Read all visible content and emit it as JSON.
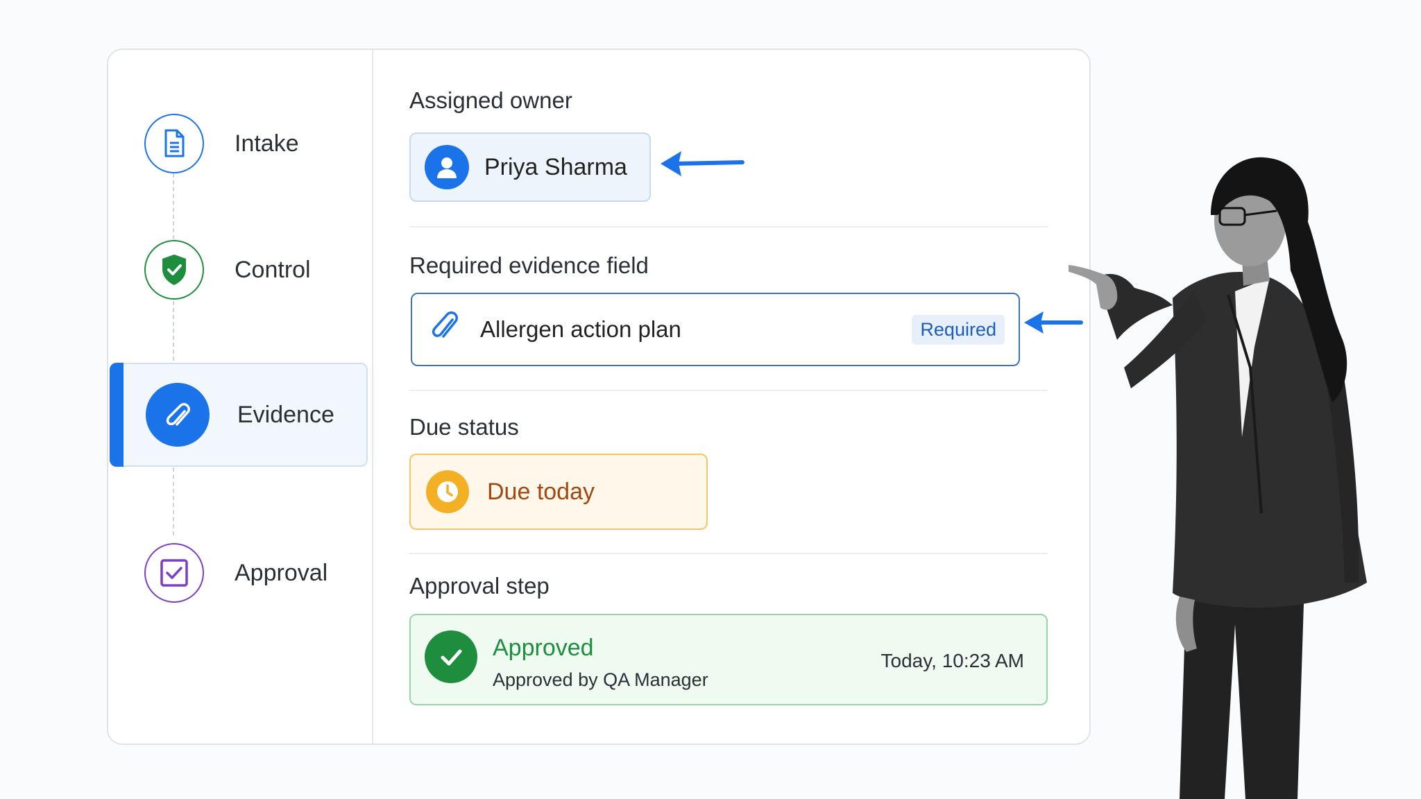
{
  "steps": [
    {
      "label": "Intake",
      "icon": "document-icon",
      "color": "#1a73e8"
    },
    {
      "label": "Control",
      "icon": "shield-check-icon",
      "color": "#1e8e3e"
    },
    {
      "label": "Evidence",
      "icon": "paperclip-icon",
      "color": "#1a73e8",
      "active": true
    },
    {
      "label": "Approval",
      "icon": "checkbox-icon",
      "color": "#7b3fc4"
    }
  ],
  "owner": {
    "title": "Assigned owner",
    "name": "Priya Sharma",
    "icon": "user-avatar-icon"
  },
  "evidence": {
    "title": "Required evidence field",
    "value": "Allergen action plan",
    "badge": "Required",
    "icon": "paperclip-icon"
  },
  "due": {
    "title": "Due status",
    "value": "Due today",
    "icon": "clock-icon",
    "color": "#f4b024"
  },
  "approval": {
    "title": "Approval step",
    "status": "Approved",
    "by": "Approved by QA Manager",
    "time": "Today, 10:23 AM",
    "icon": "check-circle-icon",
    "color": "#1e8e3e"
  },
  "accent": "#1a73e8"
}
